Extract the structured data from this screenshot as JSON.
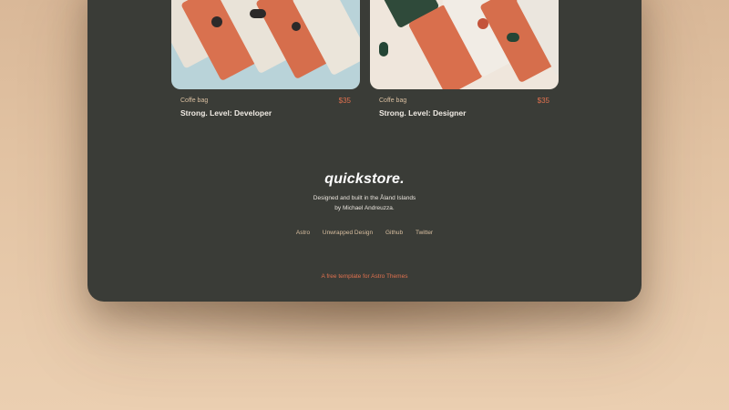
{
  "products": [
    {
      "category": "Coffe bag",
      "price": "$35",
      "title": "Strong. Level: Developer",
      "image_icon": "coffee-bag-pattern-image"
    },
    {
      "category": "Coffe bag",
      "price": "$35",
      "title": "Strong. Level: Designer",
      "image_icon": "coffee-bag-pattern-image"
    }
  ],
  "footer": {
    "brand": "quickstore.",
    "tagline_line1": "Designed and built in the Åland Islands",
    "tagline_line2": "by Michael Andreuzza.",
    "links": [
      "Astro",
      "Unwrapped Design",
      "Github",
      "Twitter"
    ],
    "credit": "A free template for Astro Themes"
  },
  "colors": {
    "panel": "#3a3c37",
    "accent": "#e0714f",
    "muted": "#d9bfa0",
    "background": "#e2c3a3"
  }
}
